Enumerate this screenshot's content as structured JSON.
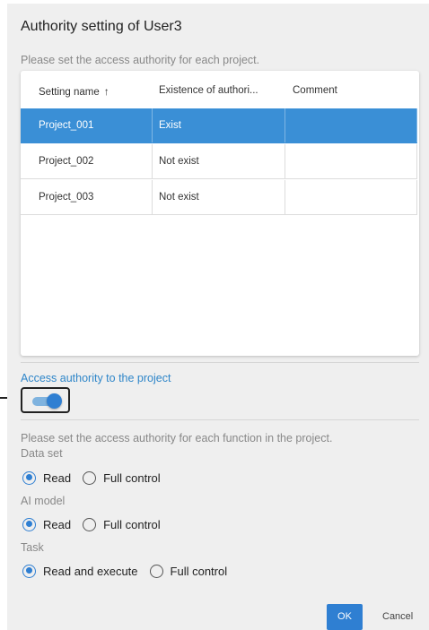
{
  "dialog": {
    "title": "Authority setting of User3",
    "subtitle": "Please set the access authority for each project."
  },
  "table": {
    "columns": {
      "name": "Setting name",
      "sort_icon": "↑",
      "existence": "Existence of authori...",
      "comment": "Comment"
    },
    "rows": [
      {
        "name": "Project_001",
        "existence": "Exist",
        "comment": "",
        "selected": true
      },
      {
        "name": "Project_002",
        "existence": "Not exist",
        "comment": "",
        "selected": false
      },
      {
        "name": "Project_003",
        "existence": "Not exist",
        "comment": "",
        "selected": false
      }
    ]
  },
  "access": {
    "label": "Access authority to the project",
    "toggle_on": true
  },
  "functions": {
    "intro": "Please set the access authority for each function in the project.",
    "dataset": {
      "label": "Data set",
      "options": [
        "Read",
        "Full control"
      ],
      "selected": "Read"
    },
    "ai_model": {
      "label": "AI model",
      "options": [
        "Read",
        "Full control"
      ],
      "selected": "Read"
    },
    "task": {
      "label": "Task",
      "options": [
        "Read and execute",
        "Full control"
      ],
      "selected": "Read and execute"
    }
  },
  "buttons": {
    "ok": "OK",
    "cancel": "Cancel"
  },
  "colors": {
    "accent": "#2f7fd2",
    "selected_row": "#3a8fd6",
    "label_blue": "#2f86c9"
  }
}
